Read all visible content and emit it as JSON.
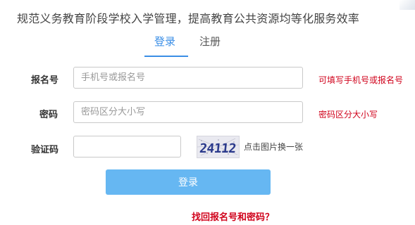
{
  "slogan": "规范义务教育阶段学校入学管理，提高教育公共资源均等化服务效率",
  "tabs": {
    "login": "登录",
    "register": "注册"
  },
  "form": {
    "username": {
      "label": "报名号",
      "placeholder": "手机号或报名号",
      "hint": "可填写手机号或报名号"
    },
    "password": {
      "label": "密码",
      "placeholder": "密码区分大小写",
      "hint": "密码区分大小写"
    },
    "captcha": {
      "label": "验证码",
      "value": "",
      "image_text": "24112",
      "refresh_label": "点击图片换一张"
    }
  },
  "login_button": "登录",
  "recover_link": "找回报名号和密码？",
  "colors": {
    "accent": "#3a8ee6",
    "button": "#66b7f2",
    "warning": "#d0021b"
  }
}
